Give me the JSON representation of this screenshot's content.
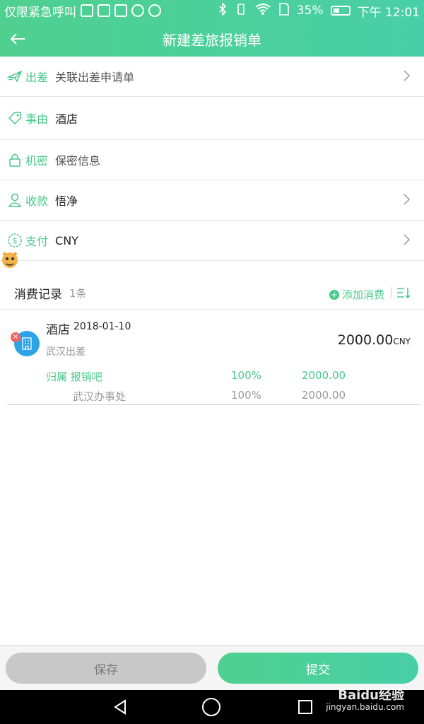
{
  "status_bar": {
    "carrier": "仅限紧急呼叫",
    "battery": "35%",
    "time": "下午 12:01"
  },
  "header": {
    "title": "新建差旅报销单"
  },
  "form": {
    "trip": {
      "label": "出差",
      "value": "关联出差申请单"
    },
    "reason": {
      "label": "事由",
      "value": "酒店"
    },
    "secret": {
      "label": "机密",
      "value": "保密信息"
    },
    "payee": {
      "label": "收款",
      "value": "悟净"
    },
    "payment": {
      "label": "支付",
      "value": "CNY"
    }
  },
  "records": {
    "title": "消费记录",
    "count": "1条",
    "add_label": "添加消费",
    "items": [
      {
        "title": "酒店",
        "date": "2018-01-10",
        "subtitle": "武汉出差",
        "amount": "2000.00",
        "currency": "CNY",
        "allocations": [
          {
            "name": "归属 报销吧",
            "percent": "100%",
            "amount": "2000.00"
          },
          {
            "name": "武汉办事处",
            "percent": "100%",
            "amount": "2000.00"
          }
        ]
      }
    ]
  },
  "footer": {
    "save_label": "保存",
    "submit_label": "提交"
  },
  "watermark": {
    "brand": "Baidu经验",
    "url": "jingyan.baidu.com"
  },
  "colors": {
    "accent": "#46c98a",
    "save_bg": "#c8c8c8",
    "expense_icon": "#2ba3e6",
    "delete": "#f26464"
  },
  "icons": {
    "trip": "airplane-icon",
    "reason": "tag-icon",
    "secret": "lock-icon",
    "payee": "user-icon",
    "payment": "dollar-icon"
  }
}
